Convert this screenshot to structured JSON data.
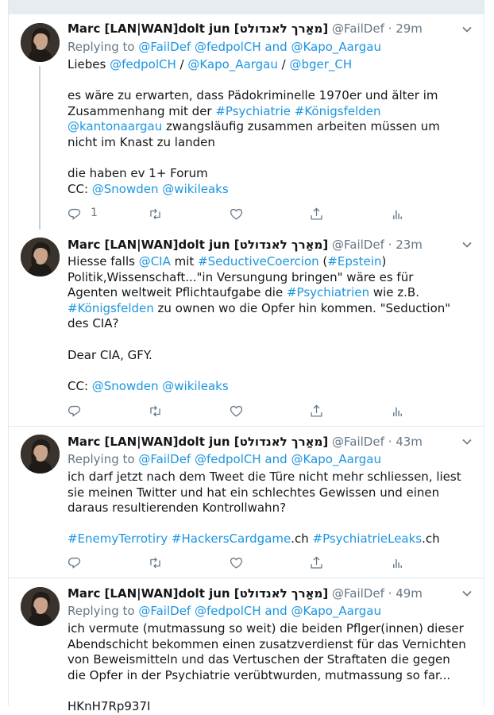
{
  "tweets": [
    {
      "name": "Marc [LAN|WAN]dolt jun [מאַרך לאנדולט]",
      "handle": "@FailDef",
      "time": "· 29m",
      "replying_prefix": "Replying to",
      "replying_to": [
        "@FailDef",
        "@fedpolCH",
        "@Kapo_Aargau"
      ],
      "replying_and": "and",
      "lines": [
        [
          {
            "t": "Liebes "
          },
          {
            "t": "@fedpolCH",
            "l": true
          },
          {
            "t": " / "
          },
          {
            "t": "@Kapo_Aargau",
            "l": true
          },
          {
            "t": " / "
          },
          {
            "t": "@bger_CH",
            "l": true
          }
        ],
        [],
        [
          {
            "t": "es wäre zu erwarten, dass Pädokriminelle 1970er und älter im"
          }
        ],
        [
          {
            "t": "Zusammenhang mit der "
          },
          {
            "t": "#Psychiatrie",
            "l": true
          },
          {
            "t": " "
          },
          {
            "t": "#Königsfelden",
            "l": true
          }
        ],
        [
          {
            "t": "@kantonaargau",
            "l": true
          },
          {
            "t": " zwangsläufig zusammen arbeiten müssen um"
          }
        ],
        [
          {
            "t": "nicht im Knast zu landen"
          }
        ],
        [],
        [
          {
            "t": "die haben ev 1+ Forum"
          }
        ],
        [
          {
            "t": "CC: "
          },
          {
            "t": "@Snowden",
            "l": true
          },
          {
            "t": " "
          },
          {
            "t": "@wikileaks",
            "l": true
          }
        ]
      ],
      "reply_count": "1"
    },
    {
      "name": "Marc [LAN|WAN]dolt jun [מאַרך לאנדולט]",
      "handle": "@FailDef",
      "time": "· 23m",
      "lines": [
        [
          {
            "t": "Hiesse falls "
          },
          {
            "t": "@CIA",
            "l": true
          },
          {
            "t": " mit "
          },
          {
            "t": "#SeductiveCoercion",
            "l": true
          },
          {
            "t": " ("
          },
          {
            "t": "#Epstein",
            "l": true
          },
          {
            "t": ")"
          }
        ],
        [
          {
            "t": "Politik,Wissenschaft..."
          },
          {
            "t": "\"in Versungung bringen\" wäre es für"
          }
        ],
        [
          {
            "t": "Agenten weltweit Pflichtaufgabe die "
          },
          {
            "t": "#Psychiatrien",
            "l": true
          },
          {
            "t": " wie z.B."
          }
        ],
        [
          {
            "t": "#Königsfelden",
            "l": true
          },
          {
            "t": " zu ownen wo die Opfer hin kommen. \"Seduction\""
          }
        ],
        [
          {
            "t": "des CIA?"
          }
        ],
        [],
        [
          {
            "t": "Dear CIA, GFY."
          }
        ],
        [],
        [
          {
            "t": "CC: "
          },
          {
            "t": "@Snowden",
            "l": true
          },
          {
            "t": " "
          },
          {
            "t": "@wikileaks",
            "l": true
          }
        ]
      ],
      "reply_count": ""
    },
    {
      "name": "Marc [LAN|WAN]dolt jun [מאַרך לאנדולט]",
      "handle": "@FailDef",
      "time": "· 43m",
      "replying_prefix": "Replying to",
      "replying_to": [
        "@FailDef",
        "@fedpolCH",
        "@Kapo_Aargau"
      ],
      "replying_and": "and",
      "lines": [
        [
          {
            "t": "ich darf jetzt nach dem Tweet die Türe nicht mehr schliessen, liest"
          }
        ],
        [
          {
            "t": "sie meinen Twitter und hat ein schlechtes Gewissen und einen"
          }
        ],
        [
          {
            "t": "daraus resultierenden Kontrollwahn?"
          }
        ],
        [],
        [
          {
            "t": "#EnemyTerrotiry",
            "l": true
          },
          {
            "t": " "
          },
          {
            "t": "#HackersCardgame",
            "l": true
          },
          {
            "t": ".ch "
          },
          {
            "t": "#PsychiatrieLeaks",
            "l": true
          },
          {
            "t": ".ch"
          }
        ]
      ],
      "reply_count": ""
    },
    {
      "name": "Marc [LAN|WAN]dolt jun [מאַרך לאנדולט]",
      "handle": "@FailDef",
      "time": "· 49m",
      "replying_prefix": "Replying to",
      "replying_to": [
        "@FailDef",
        "@fedpolCH",
        "@Kapo_Aargau"
      ],
      "replying_and": "and",
      "lines": [
        [
          {
            "t": "ich vermute (mutmassung so weit) die beiden Pflger(innen) dieser"
          }
        ],
        [
          {
            "t": "Abendschicht bekommen einen zusatzverdienst für das Vernichten"
          }
        ],
        [
          {
            "t": "von Beweismitteln und das Vertuschen der Straftaten die gegen"
          }
        ],
        [
          {
            "t": "die Opfer in der Psychiatrie verübtwurden, mutmassung so far..."
          }
        ],
        [],
        [
          {
            "t": "HKnH7Rp937I"
          }
        ]
      ],
      "reply_count": ""
    }
  ],
  "icons": {
    "reply": "reply-icon",
    "retweet": "retweet-icon",
    "like": "heart-icon",
    "share": "share-icon",
    "analytics": "analytics-icon",
    "caret": "chevron-down-icon"
  },
  "colors": {
    "link": "#1b95e0",
    "muted": "#657786",
    "border": "#e1e8ed",
    "thread_line": "#c4cfd6"
  }
}
